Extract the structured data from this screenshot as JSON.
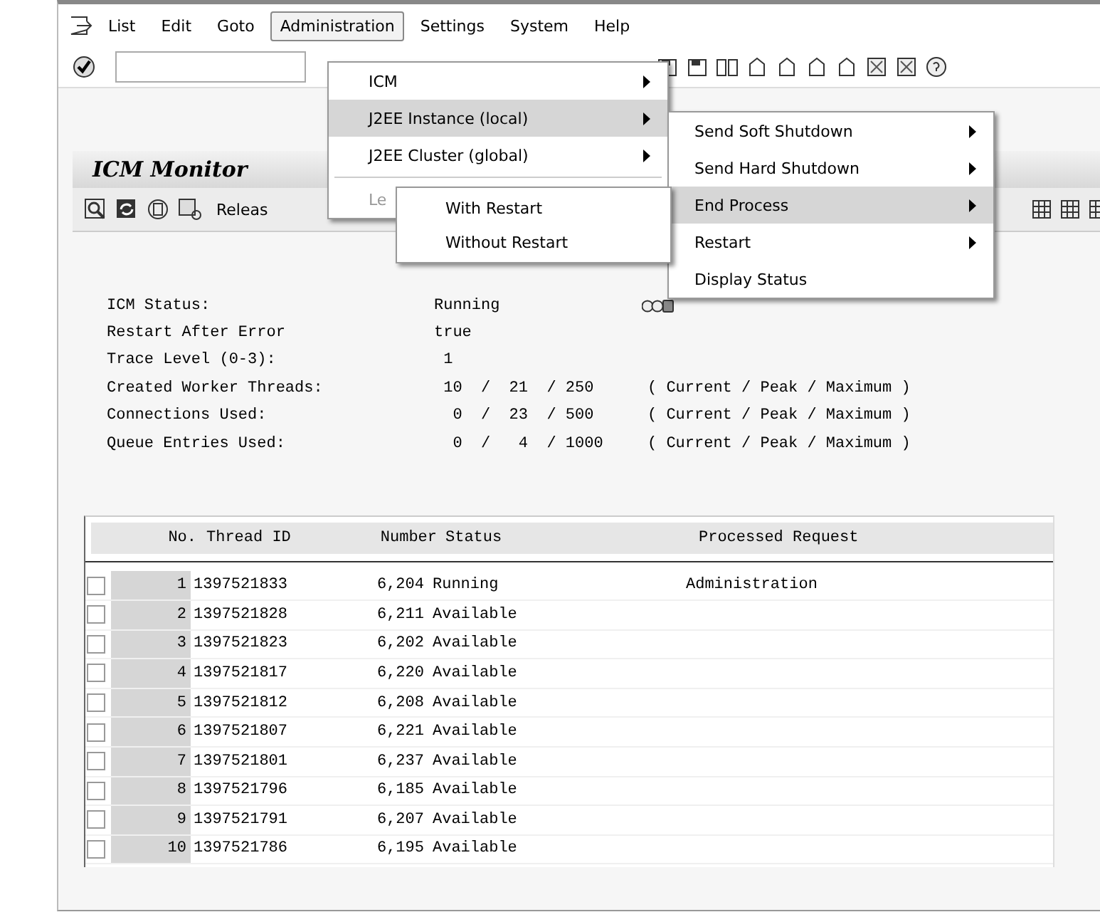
{
  "menubar": {
    "items": [
      {
        "label": "List",
        "selected": false
      },
      {
        "label": "Edit",
        "selected": false
      },
      {
        "label": "Goto",
        "selected": false
      },
      {
        "label": "Administration",
        "selected": true
      },
      {
        "label": "Settings",
        "selected": false
      },
      {
        "label": "System",
        "selected": false
      },
      {
        "label": "Help",
        "selected": false
      }
    ]
  },
  "menu": {
    "items": [
      {
        "label": "ICM",
        "kind": "item",
        "submenu": true,
        "selected": false,
        "disabled": false
      },
      {
        "label": "J2EE Instance (local)",
        "kind": "item",
        "submenu": true,
        "selected": true,
        "disabled": false
      },
      {
        "label": "J2EE Cluster (global)",
        "kind": "item",
        "submenu": true,
        "selected": false,
        "disabled": false
      },
      {
        "kind": "separator"
      },
      {
        "label": "Le",
        "kind": "item",
        "submenu": false,
        "selected": false,
        "disabled": true
      }
    ]
  },
  "submenu": {
    "items": [
      {
        "label": "Send Soft Shutdown",
        "submenu": true,
        "selected": false
      },
      {
        "label": "Send Hard Shutdown",
        "submenu": true,
        "selected": false
      },
      {
        "label": "End Process",
        "submenu": true,
        "selected": true
      },
      {
        "label": "Restart",
        "submenu": true,
        "selected": false
      },
      {
        "label": "Display Status",
        "submenu": false,
        "selected": false
      }
    ]
  },
  "end_process_menu": {
    "items": [
      {
        "label": "With Restart",
        "selected": false
      },
      {
        "label": "Without Restart",
        "selected": false
      }
    ]
  },
  "title": "ICM Monitor",
  "app_toolbar": {
    "button": "Releas"
  },
  "status": [
    {
      "label": "ICM Status:",
      "value": "Running",
      "kind": "light"
    },
    {
      "label": "Restart After Error",
      "value": "true",
      "kind": "plain"
    },
    {
      "label": "Trace Level (0-3):",
      "value": " 1",
      "kind": "plain"
    },
    {
      "label": "Created Worker Threads:",
      "value": " 10  /  21  / 250",
      "legend": "( Current / Peak / Maximum )",
      "kind": "plain"
    },
    {
      "label": "Connections Used:",
      "value": "  0  /  23  / 500",
      "legend": "( Current / Peak / Maximum )",
      "kind": "plain"
    },
    {
      "label": "Queue Entries Used:",
      "value": "  0  /   4  / 1000",
      "legend": "( Current / Peak / Maximum )",
      "kind": "plain"
    }
  ],
  "table": {
    "columns": [
      "No.",
      "Thread ID",
      "Number",
      "Status",
      "Processed Request"
    ],
    "rows": [
      {
        "no": "1",
        "thread_id": "1397521833",
        "number": "6,204",
        "status": "Running",
        "request": "Administration",
        "selected": false
      },
      {
        "no": "2",
        "thread_id": "1397521828",
        "number": "6,211",
        "status": "Available",
        "selected": false
      },
      {
        "no": "3",
        "thread_id": "1397521823",
        "number": "6,202",
        "status": "Available",
        "selected": false
      },
      {
        "no": "4",
        "thread_id": "1397521817",
        "number": "6,220",
        "status": "Available",
        "selected": false
      },
      {
        "no": "5",
        "thread_id": "1397521812",
        "number": "6,208",
        "status": "Available",
        "selected": false
      },
      {
        "no": "6",
        "thread_id": "1397521807",
        "number": "6,221",
        "status": "Available",
        "selected": false
      },
      {
        "no": "7",
        "thread_id": "1397521801",
        "number": "6,237",
        "status": "Available",
        "selected": false
      },
      {
        "no": "8",
        "thread_id": "1397521796",
        "number": "6,185",
        "status": "Available",
        "selected": false
      },
      {
        "no": "9",
        "thread_id": "1397521791",
        "number": "6,207",
        "status": "Available",
        "selected": false
      },
      {
        "no": "10",
        "thread_id": "1397521786",
        "number": "6,195",
        "status": "Available",
        "selected": false
      }
    ]
  }
}
